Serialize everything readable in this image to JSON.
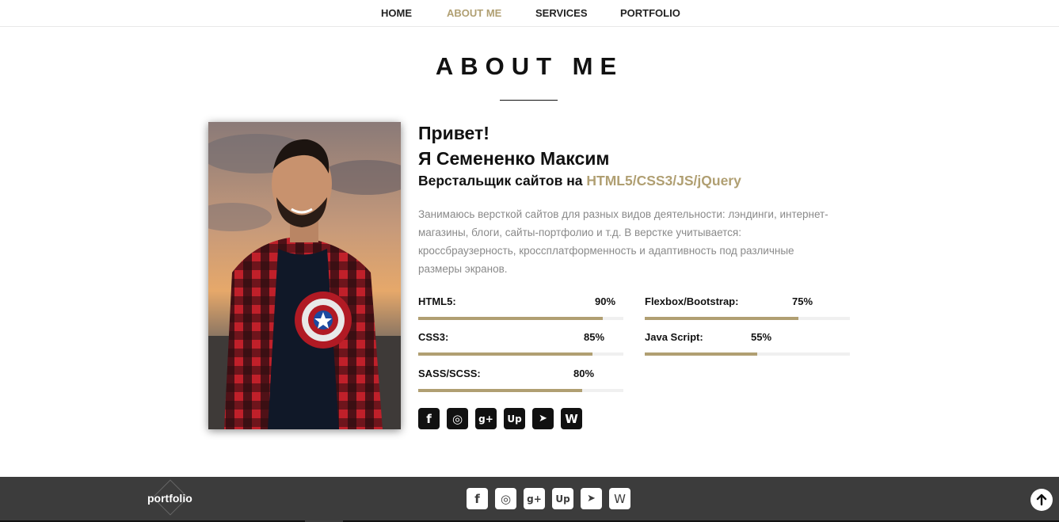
{
  "nav": {
    "items": [
      {
        "label": "HOME"
      },
      {
        "label": "ABOUT ME",
        "active": true
      },
      {
        "label": "SERVICES"
      },
      {
        "label": "PORTFOLIO"
      }
    ]
  },
  "section": {
    "title": "ABOUT ME"
  },
  "about": {
    "greeting_line1": "Привет!",
    "greeting_line2": "Я Семененко Максим",
    "role_prefix": "Верстальщик сайтов на ",
    "role_accent": "HTML5/CSS3/JS/jQuery",
    "description": "Занимаюсь версткой сайтов для разных видов деятельности: лэндинги, интернет-магазины, блоги, сайты-портфолио и т.д. В верстке учитывается: кроссбраузерность, кроссплатформенность и адаптивность под различные размеры экранов.",
    "photo_alt": "portrait-photo"
  },
  "skills": [
    {
      "name": "HTML5:",
      "percent_label": "90%",
      "value": 90
    },
    {
      "name": "CSS3:",
      "percent_label": "85%",
      "value": 85
    },
    {
      "name": "SASS/SCSS:",
      "percent_label": "80%",
      "value": 80
    },
    {
      "name": "Flexbox/Bootstrap:",
      "percent_label": "75%",
      "value": 75
    },
    {
      "name": "Java Script:",
      "percent_label": "55%",
      "value": 55
    }
  ],
  "social": {
    "icons": [
      "facebook-icon",
      "instagram-icon",
      "google-plus-icon",
      "upwork-icon",
      "telegram-icon",
      "w-icon"
    ],
    "glyphs": [
      "f",
      "◎",
      "g+",
      "Up",
      "➤",
      "W"
    ]
  },
  "footer": {
    "logo": "portfolio"
  },
  "colors": {
    "accent": "#b09f72",
    "footer_bg": "#3c3c3c",
    "text": "#111111",
    "muted": "#8a8a8a"
  }
}
